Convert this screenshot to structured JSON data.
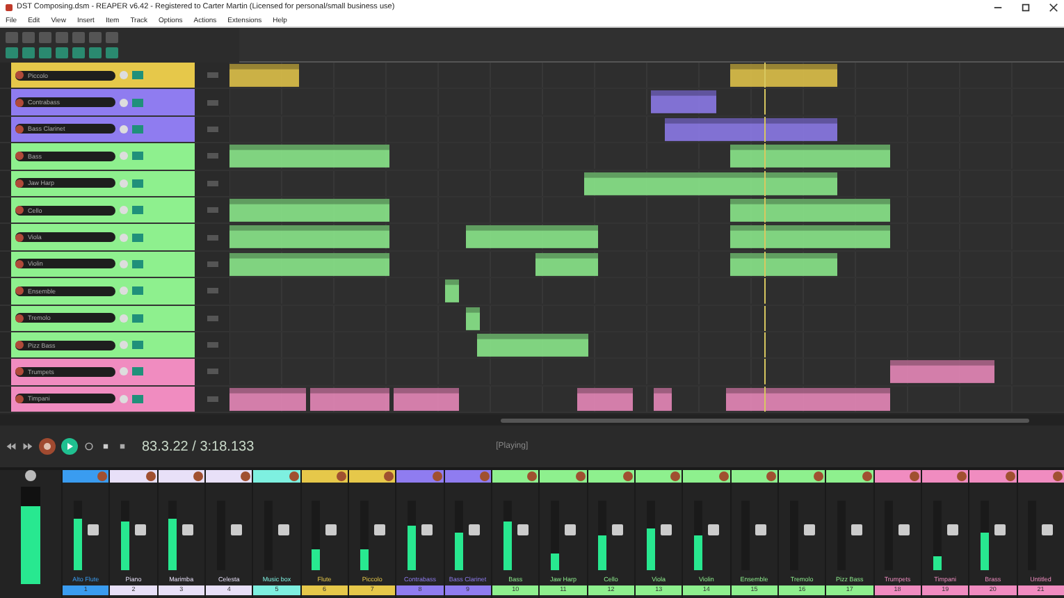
{
  "window": {
    "title": "DST Composing.dsm - REAPER v6.42 - Registered to Carter Martin (Licensed for personal/small business use)"
  },
  "menu": [
    "File",
    "Edit",
    "View",
    "Insert",
    "Item",
    "Track",
    "Options",
    "Actions",
    "Extensions",
    "Help"
  ],
  "tracks": [
    {
      "name": "Piccolo",
      "color": "#e6c84a"
    },
    {
      "name": "Contrabass",
      "color": "#8f7cf0"
    },
    {
      "name": "Bass Clarinet",
      "color": "#8f7cf0"
    },
    {
      "name": "Bass",
      "color": "#8ef08e"
    },
    {
      "name": "Jaw Harp",
      "color": "#8ef08e"
    },
    {
      "name": "Cello",
      "color": "#8ef08e"
    },
    {
      "name": "Viola",
      "color": "#8ef08e"
    },
    {
      "name": "Violin",
      "color": "#8ef08e"
    },
    {
      "name": "Ensemble",
      "color": "#8ef08e"
    },
    {
      "name": "Tremolo",
      "color": "#8ef08e"
    },
    {
      "name": "Pizz Bass",
      "color": "#8ef08e"
    },
    {
      "name": "Trumpets",
      "color": "#f08cc0"
    },
    {
      "name": "Timpani",
      "color": "#f08cc0"
    }
  ],
  "transport": {
    "time": "83.3.22 / 3:18.133",
    "status": "[Playing]"
  },
  "mixer": {
    "master": {
      "level": 0.8
    },
    "strips": [
      {
        "name": "Alto Flute",
        "number": "1",
        "color": "#3a9cf0",
        "level": 0.75
      },
      {
        "name": "Piano",
        "number": "2",
        "color": "#e8e0f8",
        "level": 0.7
      },
      {
        "name": "Marimba",
        "number": "3",
        "color": "#e8e0f8",
        "level": 0.75
      },
      {
        "name": "Celesta",
        "number": "4",
        "color": "#e8e0f8",
        "level": 0
      },
      {
        "name": "Music box",
        "number": "5",
        "color": "#7ef0e0",
        "level": 0
      },
      {
        "name": "Flute",
        "number": "6",
        "color": "#e6c84a",
        "level": 0.3
      },
      {
        "name": "Piccolo",
        "number": "7",
        "color": "#e6c84a",
        "level": 0.3
      },
      {
        "name": "Contrabass",
        "number": "8",
        "color": "#8f7cf0",
        "level": 0.65
      },
      {
        "name": "Bass Clarinet",
        "number": "9",
        "color": "#8f7cf0",
        "level": 0.55
      },
      {
        "name": "Bass",
        "number": "10",
        "color": "#8ef08e",
        "level": 0.7
      },
      {
        "name": "Jaw Harp",
        "number": "11",
        "color": "#8ef08e",
        "level": 0.25
      },
      {
        "name": "Cello",
        "number": "12",
        "color": "#8ef08e",
        "level": 0.5
      },
      {
        "name": "Viola",
        "number": "13",
        "color": "#8ef08e",
        "level": 0.6
      },
      {
        "name": "Violin",
        "number": "14",
        "color": "#8ef08e",
        "level": 0.5
      },
      {
        "name": "Ensemble",
        "number": "15",
        "color": "#8ef08e",
        "level": 0
      },
      {
        "name": "Tremolo",
        "number": "16",
        "color": "#8ef08e",
        "level": 0
      },
      {
        "name": "Pizz Bass",
        "number": "17",
        "color": "#8ef08e",
        "level": 0
      },
      {
        "name": "Trumpets",
        "number": "18",
        "color": "#f08cc0",
        "level": 0
      },
      {
        "name": "Timpani",
        "number": "19",
        "color": "#f08cc0",
        "level": 0.2
      },
      {
        "name": "Brass",
        "number": "20",
        "color": "#f08cc0",
        "level": 0.55
      },
      {
        "name": "Untitled",
        "number": "21",
        "color": "#f08cc0",
        "level": 0
      }
    ]
  }
}
